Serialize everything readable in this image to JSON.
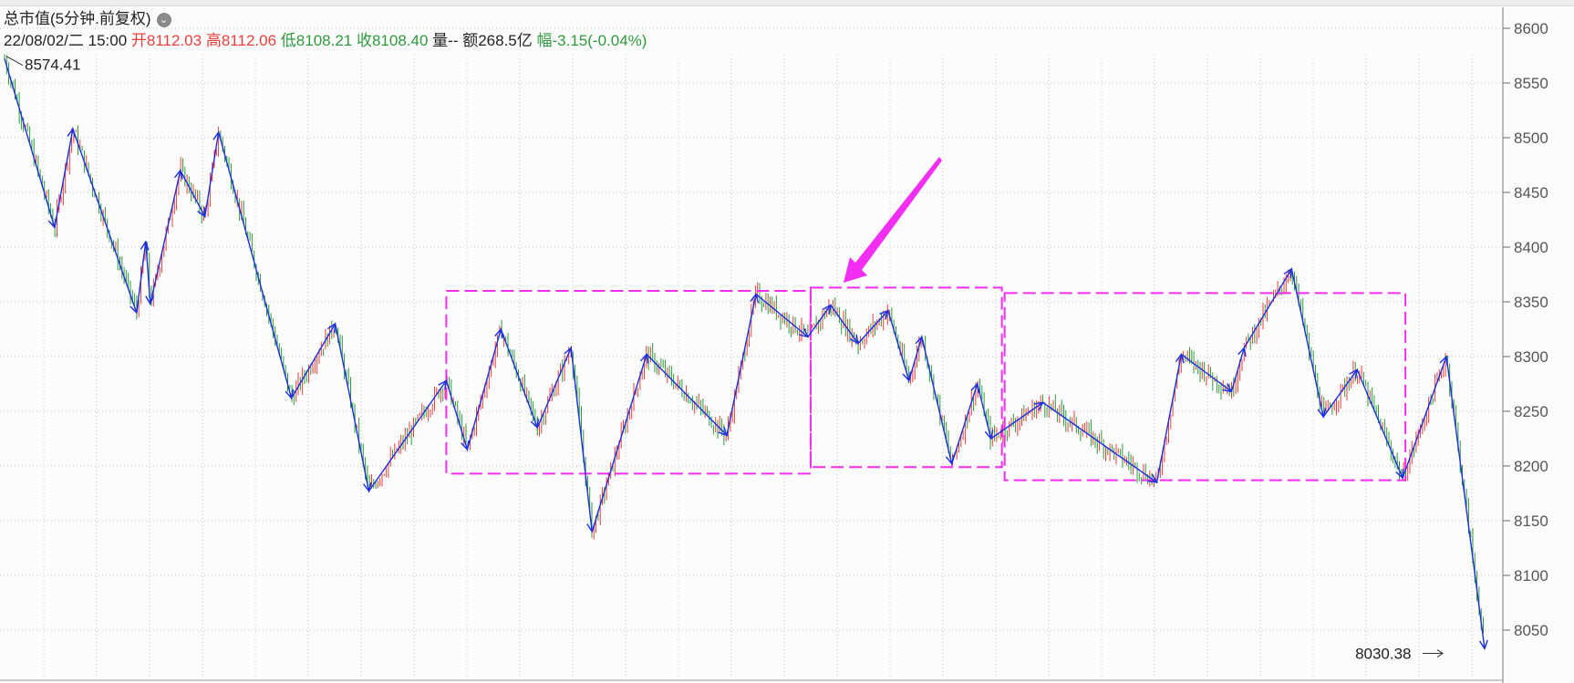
{
  "header": {
    "title": "总市值(5分钟.前复权)",
    "date": "22/08/02/二 15:00",
    "open_label": "开",
    "open": "8112.03",
    "high_label": "高",
    "high": "8112.06",
    "low_label": "低",
    "low": "8108.21",
    "close_label": "收",
    "close": "8108.40",
    "vol_label": "量",
    "vol": "--",
    "amt_label": "额",
    "amt": "268.5亿",
    "chg_label": "幅",
    "chg": "-3.15(-0.04%)"
  },
  "colors": {
    "up": "#e8413c",
    "down": "#2f9a3c",
    "zigzag": "#1b2fe0",
    "box": "#f22ef2",
    "grid": "#c8c8c8"
  },
  "chart_data": {
    "type": "line",
    "ylim": [
      8025,
      8620
    ],
    "yticks": [
      8050,
      8100,
      8150,
      8200,
      8250,
      8300,
      8350,
      8400,
      8450,
      8500,
      8550,
      8600
    ],
    "grid": true,
    "x_range": [
      0,
      1650
    ],
    "annotations": {
      "high_label": "8574.41",
      "low_label": "8030.38"
    },
    "series": [
      {
        "x": [
          5,
          60,
          80,
          150,
          160,
          165,
          198,
          225,
          240,
          320,
          368,
          405,
          490,
          513,
          550,
          590,
          627,
          650,
          710,
          798,
          830,
          887,
          912,
          942,
          975,
          998,
          1012,
          1045,
          1073,
          1088,
          1145,
          1270,
          1297,
          1352,
          1366,
          1418,
          1453,
          1490,
          1540,
          1588,
          1630
        ],
        "y": [
          8572,
          8418,
          8508,
          8340,
          8405,
          8348,
          8470,
          8428,
          8505,
          8262,
          8330,
          8177,
          8278,
          8215,
          8325,
          8235,
          8308,
          8140,
          8302,
          8228,
          8357,
          8318,
          8347,
          8312,
          8342,
          8278,
          8318,
          8202,
          8275,
          8225,
          8258,
          8185,
          8302,
          8268,
          8308,
          8380,
          8245,
          8288,
          8189,
          8300,
          8033
        ]
      }
    ],
    "boxes": [
      {
        "x0": 490,
        "x1": 890,
        "y0": 8193,
        "y1": 8360
      },
      {
        "x0": 890,
        "x1": 1100,
        "y0": 8199,
        "y1": 8363
      },
      {
        "x0": 1103,
        "x1": 1543,
        "y0": 8187,
        "y1": 8358
      }
    ]
  }
}
